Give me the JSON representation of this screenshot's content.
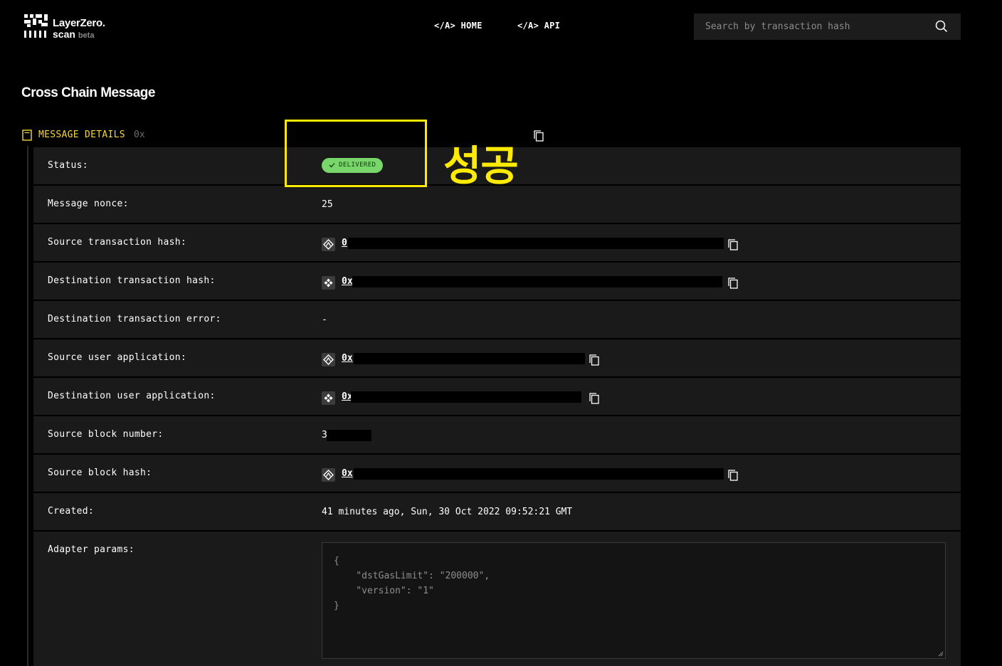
{
  "header": {
    "brand": "LayerZero.",
    "brand_sub": "scan",
    "brand_tag": "beta",
    "nav": [
      {
        "label": "</A> HOME"
      },
      {
        "label": "</A> API"
      }
    ],
    "search": {
      "placeholder": "Search by transaction hash",
      "icon": "search-icon"
    }
  },
  "page": {
    "title": "Cross Chain Message"
  },
  "section": {
    "label": "MESSAGE DETAILS",
    "hash_prefix": "0x",
    "icon": "document-icon",
    "copy_icon": "copy-icon"
  },
  "annotation": {
    "text": "성공",
    "color": "#ffeb00"
  },
  "status_color": "#78d66a",
  "accent_color": "#f5d73a",
  "rows": [
    {
      "key": "Status:",
      "badge": "DELIVERED"
    },
    {
      "key": "Message nonce:",
      "value": "25"
    },
    {
      "key": "Source transaction hash:",
      "value": "0",
      "chain_icon": "source-chain-icon"
    },
    {
      "key": "Destination transaction hash:",
      "value": "0x",
      "chain_icon": "bnb-chain-icon"
    },
    {
      "key": "Destination transaction error:",
      "value": "-"
    },
    {
      "key": "Source user application:",
      "value": "0x",
      "chain_icon": "source-chain-icon"
    },
    {
      "key": "Destination user application:",
      "value": "0x",
      "chain_icon": "bnb-chain-icon"
    },
    {
      "key": "Source block number:",
      "value": "3"
    },
    {
      "key": "Source block hash:",
      "value": "0x",
      "chain_icon": "source-chain-icon"
    },
    {
      "key": "Created:",
      "value": "41 minutes ago, Sun, 30 Oct 2022 09:52:21 GMT"
    },
    {
      "key": "Adapter params:",
      "value": "{\n    \"dstGasLimit\": \"200000\",\n    \"version\": \"1\"\n}"
    }
  ]
}
